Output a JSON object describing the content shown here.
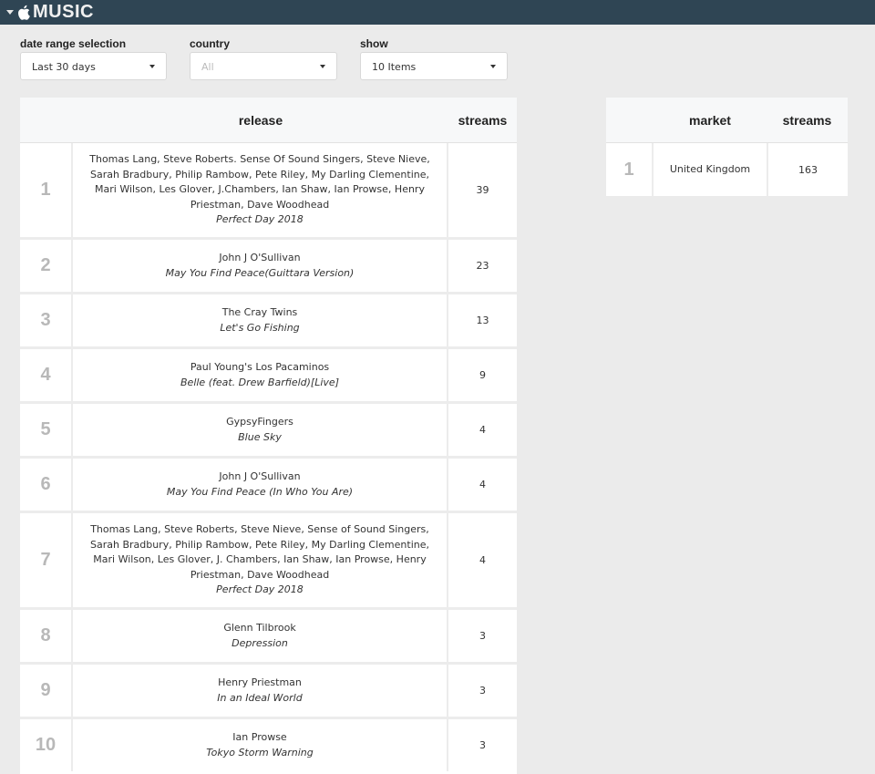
{
  "header": {
    "brand": "MUSIC",
    "logo_icon": "apple-icon"
  },
  "filters": [
    {
      "label": "date range selection",
      "value": "Last 30 days",
      "disabled": false
    },
    {
      "label": "country",
      "value": "All",
      "disabled": true
    },
    {
      "label": "show",
      "value": "10 Items",
      "disabled": false
    }
  ],
  "releases_table": {
    "columns": [
      "release",
      "streams"
    ],
    "rows": [
      {
        "rank": "1",
        "artist": "Thomas Lang, Steve Roberts. Sense Of Sound Singers, Steve Nieve, Sarah Bradbury, Philip Rambow, Pete Riley, My Darling Clementine, Mari Wilson, Les Glover, J.Chambers, Ian Shaw, Ian Prowse, Henry Priestman, Dave Woodhead",
        "title": "Perfect Day 2018",
        "streams": "39"
      },
      {
        "rank": "2",
        "artist": "John J O'Sullivan",
        "title": "May You Find Peace(Guittara Version)",
        "streams": "23"
      },
      {
        "rank": "3",
        "artist": "The Cray Twins",
        "title": "Let's Go Fishing",
        "streams": "13"
      },
      {
        "rank": "4",
        "artist": "Paul Young's Los Pacaminos",
        "title": "Belle (feat. Drew Barfield)[Live]",
        "streams": "9"
      },
      {
        "rank": "5",
        "artist": "GypsyFingers",
        "title": "Blue Sky",
        "streams": "4"
      },
      {
        "rank": "6",
        "artist": "John J O'Sullivan",
        "title": "May You Find Peace (In Who You Are)",
        "streams": "4"
      },
      {
        "rank": "7",
        "artist": "Thomas Lang, Steve Roberts, Steve Nieve, Sense of Sound Singers, Sarah Bradbury, Philip Rambow, Pete Riley, My Darling Clementine, Mari Wilson, Les Glover, J. Chambers, Ian Shaw, Ian Prowse, Henry Priestman, Dave Woodhead",
        "title": "Perfect Day 2018",
        "streams": "4"
      },
      {
        "rank": "8",
        "artist": "Glenn Tilbrook",
        "title": "Depression",
        "streams": "3"
      },
      {
        "rank": "9",
        "artist": "Henry Priestman",
        "title": "In an Ideal World",
        "streams": "3"
      },
      {
        "rank": "10",
        "artist": "Ian Prowse",
        "title": "Tokyo Storm Warning",
        "streams": "3"
      }
    ]
  },
  "market_table": {
    "columns": [
      "market",
      "streams"
    ],
    "rows": [
      {
        "rank": "1",
        "market": "United Kingdom",
        "streams": "163"
      }
    ]
  }
}
